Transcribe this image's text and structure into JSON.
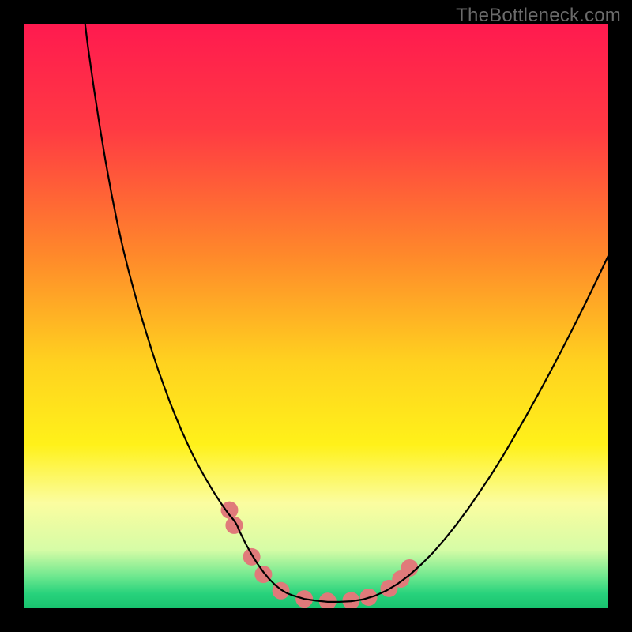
{
  "watermark": "TheBottleneck.com",
  "chart_data": {
    "type": "line",
    "title": "",
    "xlabel": "",
    "ylabel": "",
    "xlim": [
      0,
      100
    ],
    "ylim": [
      0,
      100
    ],
    "grid": false,
    "legend": false,
    "gradient_stops": [
      {
        "offset": 0.0,
        "color": "#ff1a4f"
      },
      {
        "offset": 0.18,
        "color": "#ff3a43"
      },
      {
        "offset": 0.4,
        "color": "#ff8a2a"
      },
      {
        "offset": 0.58,
        "color": "#ffd21f"
      },
      {
        "offset": 0.72,
        "color": "#fff11a"
      },
      {
        "offset": 0.82,
        "color": "#fbfda0"
      },
      {
        "offset": 0.9,
        "color": "#d6fca6"
      },
      {
        "offset": 0.945,
        "color": "#6fe88f"
      },
      {
        "offset": 0.975,
        "color": "#28d27c"
      },
      {
        "offset": 1.0,
        "color": "#18c26e"
      }
    ],
    "series": [
      {
        "name": "curve",
        "color": "#000000",
        "stroke_width": 2.2,
        "x": [
          10.5,
          11,
          12,
          13,
          14,
          15,
          16,
          17,
          18,
          19,
          20,
          21,
          22,
          23,
          24,
          25,
          26,
          27,
          28,
          29,
          30,
          31,
          32,
          33,
          34,
          35,
          36,
          36.5,
          37,
          38,
          39,
          40,
          41,
          42,
          43,
          44,
          45,
          46,
          48,
          50,
          52,
          54,
          56,
          58,
          60,
          62,
          64,
          66,
          68,
          70,
          72,
          74,
          76,
          78,
          80,
          82,
          84,
          86,
          88,
          90,
          92,
          94,
          96,
          98,
          100
        ],
        "y": [
          100,
          96,
          89,
          82.5,
          76.5,
          71,
          66,
          61.5,
          57.5,
          53.8,
          50.3,
          47,
          43.8,
          40.8,
          38,
          35.3,
          32.8,
          30.4,
          28.2,
          26.1,
          24.2,
          22.4,
          20.7,
          19.1,
          17.6,
          16.2,
          15,
          14.2,
          13,
          11,
          9.2,
          7.6,
          6.2,
          5,
          4,
          3.2,
          2.6,
          2.2,
          1.6,
          1.3,
          1.1,
          1.1,
          1.2,
          1.5,
          2.1,
          3,
          4.2,
          5.7,
          7.5,
          9.5,
          11.8,
          14.3,
          17,
          19.9,
          22.9,
          26.1,
          29.5,
          33,
          36.6,
          40.3,
          44.1,
          48,
          52,
          56.1,
          60.3
        ]
      }
    ],
    "markers": {
      "name": "dots",
      "color": "#e07a7a",
      "radius": 11,
      "points": [
        {
          "x": 35.2,
          "y": 16.8
        },
        {
          "x": 36.0,
          "y": 14.2
        },
        {
          "x": 39.0,
          "y": 8.8
        },
        {
          "x": 41.0,
          "y": 5.8
        },
        {
          "x": 44.0,
          "y": 3.0
        },
        {
          "x": 48.0,
          "y": 1.6
        },
        {
          "x": 52.0,
          "y": 1.2
        },
        {
          "x": 56.0,
          "y": 1.3
        },
        {
          "x": 59.0,
          "y": 1.9
        },
        {
          "x": 62.5,
          "y": 3.4
        },
        {
          "x": 64.5,
          "y": 5.0
        },
        {
          "x": 66.0,
          "y": 6.9
        }
      ]
    }
  }
}
